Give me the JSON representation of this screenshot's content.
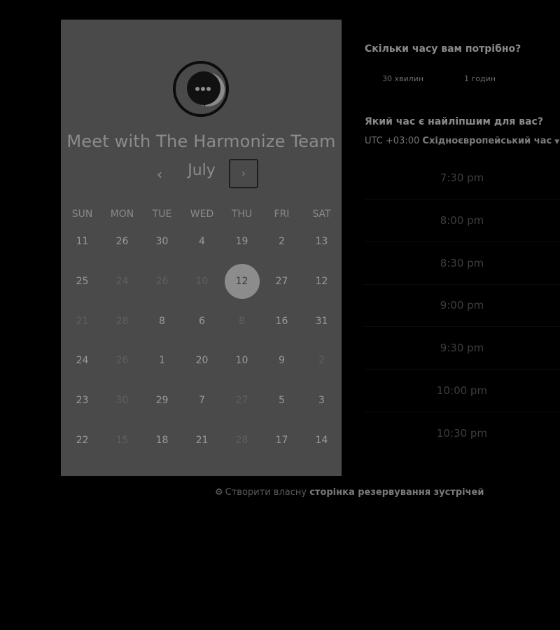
{
  "booking": {
    "title": "Meet with The Harmonize Team",
    "month": "July",
    "prev_icon": "‹",
    "next_icon": "›",
    "weekdays": [
      "SUN",
      "MON",
      "TUE",
      "WED",
      "THU",
      "FRI",
      "SAT"
    ],
    "weeks": [
      [
        {
          "d": "11",
          "dim": false
        },
        {
          "d": "26",
          "dim": false
        },
        {
          "d": "30",
          "dim": false
        },
        {
          "d": "4",
          "dim": false
        },
        {
          "d": "19",
          "dim": false
        },
        {
          "d": "2",
          "dim": false
        },
        {
          "d": "13",
          "dim": false
        }
      ],
      [
        {
          "d": "25",
          "dim": false
        },
        {
          "d": "24",
          "dim": true
        },
        {
          "d": "26",
          "dim": true
        },
        {
          "d": "10",
          "dim": true
        },
        {
          "d": "12",
          "dim": false,
          "selected": true
        },
        {
          "d": "27",
          "dim": false
        },
        {
          "d": "12",
          "dim": false
        }
      ],
      [
        {
          "d": "21",
          "dim": true
        },
        {
          "d": "28",
          "dim": true
        },
        {
          "d": "8",
          "dim": false
        },
        {
          "d": "6",
          "dim": false
        },
        {
          "d": "8",
          "dim": true
        },
        {
          "d": "16",
          "dim": false
        },
        {
          "d": "31",
          "dim": false
        }
      ],
      [
        {
          "d": "24",
          "dim": false
        },
        {
          "d": "26",
          "dim": true
        },
        {
          "d": "1",
          "dim": false
        },
        {
          "d": "20",
          "dim": false
        },
        {
          "d": "10",
          "dim": false
        },
        {
          "d": "9",
          "dim": false
        },
        {
          "d": "2",
          "dim": true
        }
      ],
      [
        {
          "d": "23",
          "dim": false
        },
        {
          "d": "30",
          "dim": true
        },
        {
          "d": "29",
          "dim": false
        },
        {
          "d": "7",
          "dim": false
        },
        {
          "d": "27",
          "dim": true
        },
        {
          "d": "5",
          "dim": false
        },
        {
          "d": "3",
          "dim": false
        }
      ],
      [
        {
          "d": "22",
          "dim": false
        },
        {
          "d": "15",
          "dim": true
        },
        {
          "d": "18",
          "dim": false
        },
        {
          "d": "21",
          "dim": false
        },
        {
          "d": "28",
          "dim": true
        },
        {
          "d": "17",
          "dim": false
        },
        {
          "d": "14",
          "dim": false
        }
      ]
    ]
  },
  "duration": {
    "question": "Скільки часу вам потрібно?",
    "options": [
      "30 хвилин",
      "1 годин"
    ]
  },
  "time": {
    "question": "Який час є найліпшим для вас?",
    "tz_offset": "UTC +03:00",
    "tz_name": "Східноєвропейський час",
    "slots": [
      "7:30 pm",
      "8:00 pm",
      "8:30 pm",
      "9:00 pm",
      "9:30 pm",
      "10:00 pm",
      "10:30 pm"
    ]
  },
  "footer": {
    "prefix": "Створити власну",
    "link": "сторінка резервування зустрічей"
  }
}
